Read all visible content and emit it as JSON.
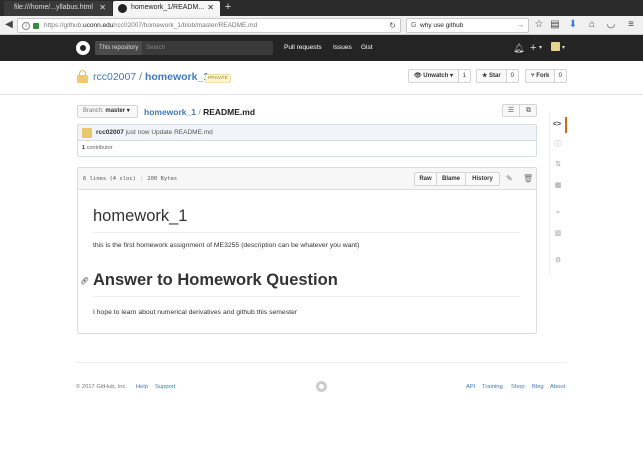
{
  "browser": {
    "tabs": [
      {
        "label": "file:///home/...yllabus.html",
        "active": false
      },
      {
        "label": "homework_1/READM...",
        "active": true
      }
    ],
    "url_prefix": "https://github.",
    "url_domain": "uconn.edu",
    "url_path": "/rcc02007/homework_1/blob/master/README.md",
    "search_text": "why use github",
    "icons": [
      "back-icon",
      "info-icon",
      "lock-icon",
      "reload-icon",
      "search-icon",
      "go-arrow-icon",
      "star-icon",
      "clipboard-icon",
      "download-icon",
      "home-icon",
      "pocket-icon",
      "menu-icon"
    ]
  },
  "gh_header": {
    "search_scope": "This repository",
    "search_placeholder": "Search",
    "nav": [
      "Pull requests",
      "Issues",
      "Gist"
    ],
    "plus": "+",
    "caret": "▾"
  },
  "repo": {
    "owner": "rcc02007",
    "separator": "/",
    "name": "homework_1",
    "badge": "PRIVATE",
    "unwatch_label": "Unwatch ▾",
    "unwatch_count": "1",
    "star_label": "Star",
    "star_count": "0",
    "fork_label": "Fork",
    "fork_count": "0"
  },
  "filenav": {
    "branch_key": "Branch:",
    "branch_value": "master",
    "branch_caret": "▾",
    "crumb_repo": "homework_1",
    "crumb_sep": "/",
    "crumb_file": "README.md"
  },
  "commit": {
    "author": "rcc02007",
    "time": "just now",
    "message": "Update README.md",
    "contributors_count": "1",
    "contributors_label": "contributor"
  },
  "file": {
    "lines": "6 lines (4 sloc)",
    "size": "200 Bytes",
    "buttons": [
      "Raw",
      "Blame",
      "History"
    ],
    "h1": "homework_1",
    "p1": "this is the first homework assignment of ME3255 (description can be whatever you want)",
    "h2": "Answer to Homework Question",
    "p2": "I hope to learn about numerical derivatives and github this semester"
  },
  "footer": {
    "copyright": "© 2017 GitHub, Inc.",
    "left_links": [
      "Help",
      "Support"
    ],
    "right_links": [
      "API",
      "Training",
      "Shop",
      "Blog",
      "About"
    ]
  }
}
